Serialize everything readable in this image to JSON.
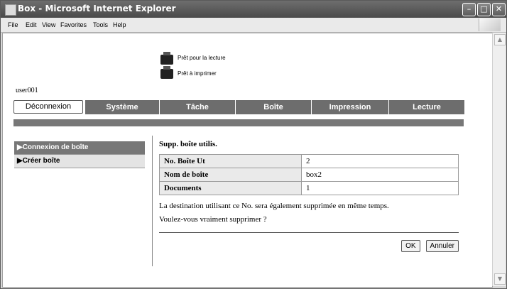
{
  "window": {
    "title": "Box - Microsoft Internet Explorer"
  },
  "menu": [
    "File",
    "Edit",
    "View",
    "Favorites",
    "Tools",
    "Help"
  ],
  "status": {
    "reading": "Prêt pour la lecture",
    "printing": "Prêt à imprimer"
  },
  "user": "user001",
  "tabs": {
    "logout": "Déconnexion",
    "items": [
      "Système",
      "Tâche",
      "Boîte",
      "Impression",
      "Lecture"
    ]
  },
  "sidebar": {
    "items": [
      "Connexion de boîte",
      "Créer boîte"
    ]
  },
  "main": {
    "title": "Supp. boîte utilis.",
    "rows": [
      {
        "label": "No. Boîte Ut",
        "value": "2"
      },
      {
        "label": "Nom de boîte",
        "value": "box2"
      },
      {
        "label": "Documents",
        "value": "1"
      }
    ],
    "message1": "La destination utilisant ce No. sera également supprimée en même temps.",
    "message2": "Voulez-vous vraiment supprimer ?",
    "ok": "OK",
    "cancel": "Annuler"
  }
}
